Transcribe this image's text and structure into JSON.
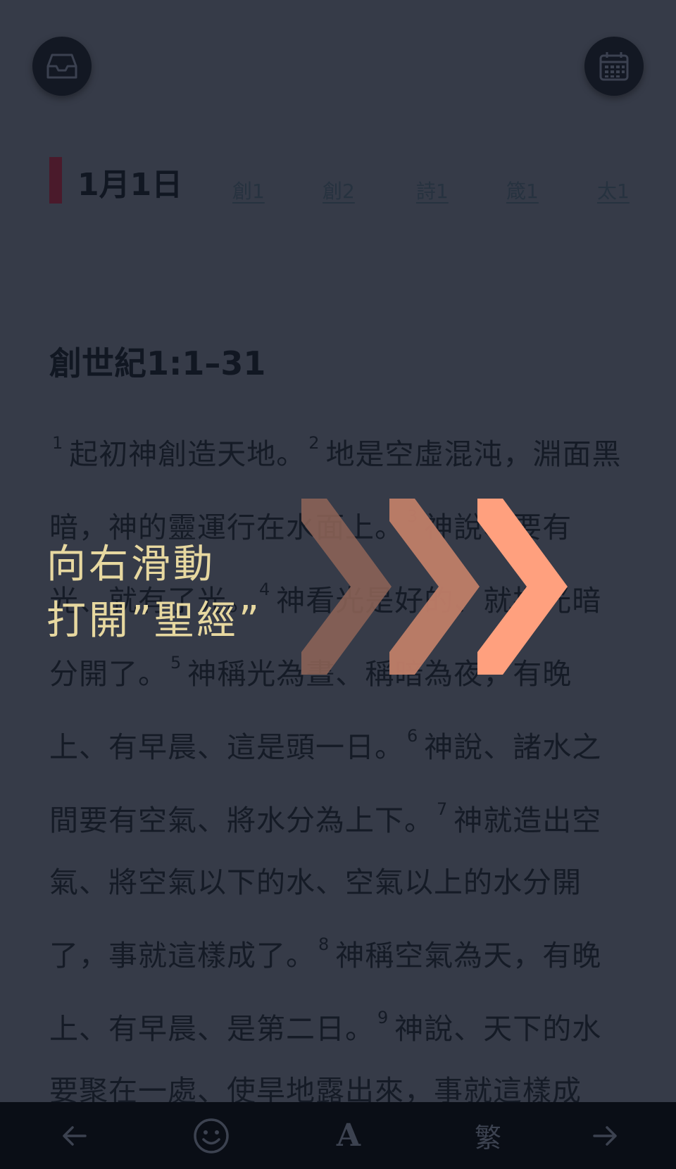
{
  "header": {
    "inbox_icon": "inbox-tray-icon",
    "calendar_icon": "calendar-icon"
  },
  "reading_plan": {
    "date": "1月1日",
    "refs": [
      "創1",
      "創2",
      "詩1",
      "箴1",
      "太1"
    ]
  },
  "passage": {
    "title": "創世紀1:1–31",
    "verses": [
      {
        "n": "1",
        "text": "起初神創造天地。"
      },
      {
        "n": "2",
        "text": "地是空虛混沌，淵面黑暗，神的靈運行在水面上。"
      },
      {
        "n": "3",
        "text": "神說、要有光、就有了光。"
      },
      {
        "n": "4",
        "text": "神看光是好的、就把光暗分開了。"
      },
      {
        "n": "5",
        "text": "神稱光為晝、稱暗為夜，有晚上、有早晨、這是頭一日。"
      },
      {
        "n": "6",
        "text": "神說、諸水之間要有空氣、將水分為上下。"
      },
      {
        "n": "7",
        "text": "神就造出空氣、將空氣以下的水、空氣以上的水分開了，事就這樣成了。"
      },
      {
        "n": "8",
        "text": "神稱空氣為天，有晚上、有早晨、是第二日。"
      },
      {
        "n": "9",
        "text": "神說、天下的水要聚在一處、使旱地露出來，事就這樣成"
      }
    ]
  },
  "overlay": {
    "line1": "向右滑動",
    "line2": "打開”聖經”",
    "chevron_colors": [
      "#8f6558",
      "#c07e68",
      "#ffa07e"
    ]
  },
  "toolbar": {
    "back_icon": "arrow-left-icon",
    "emoji_icon": "smiley-icon",
    "font_label": "A",
    "lang_label": "繁",
    "forward_icon": "arrow-right-icon"
  }
}
